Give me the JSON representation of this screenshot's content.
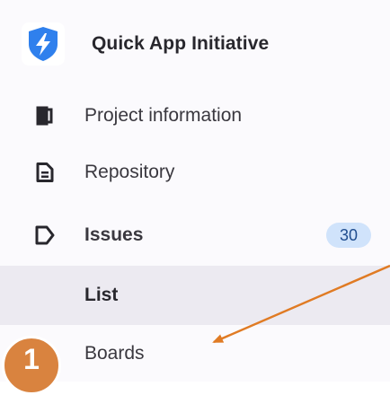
{
  "project": {
    "name": "Quick App Initiative",
    "avatar_icon": "lightning-shield-icon"
  },
  "nav": {
    "project_information": "Project information",
    "repository": "Repository",
    "issues": "Issues",
    "issues_count": "30",
    "list": "List",
    "boards": "Boards"
  },
  "annotation": {
    "step_number": "1",
    "badge_color": "#d9833f",
    "arrow_color": "#e07b24"
  },
  "colors": {
    "accent": "#2f80ed",
    "active_bg": "#eceaf1",
    "badge_bg": "#d0e3fb"
  }
}
